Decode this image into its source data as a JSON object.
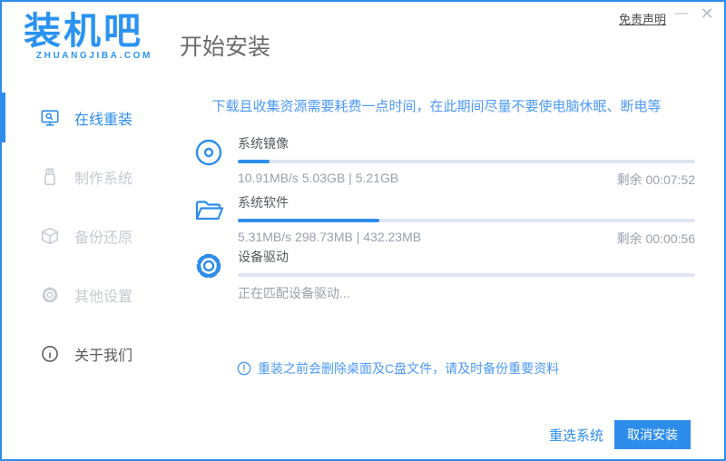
{
  "titlebar": {
    "disclaimer": "免责声明",
    "minimize_glyph": "—",
    "close_glyph": "✕"
  },
  "logo": {
    "brand": "装机吧",
    "domain": "ZHUANGJIBA.COM"
  },
  "header": {
    "title": "开始安装"
  },
  "sidebar": {
    "items": [
      {
        "label": "在线重装",
        "icon": "monitor-reinstall-icon",
        "active": true
      },
      {
        "label": "制作系统",
        "icon": "usb-drive-icon",
        "active": false
      },
      {
        "label": "备份还原",
        "icon": "backup-box-icon",
        "active": false
      },
      {
        "label": "其他设置",
        "icon": "gear-icon",
        "active": false
      },
      {
        "label": "关于我们",
        "icon": "info-icon",
        "active": false
      }
    ]
  },
  "main": {
    "warning": "下载且收集资源需要耗费一点时间，在此期间尽量不要使电脑休眠、断电等",
    "tasks": [
      {
        "name": "系统镜像",
        "icon": "disc-icon",
        "progress_percent": 7,
        "stats": "10.91MB/s 5.03GB | 5.21GB",
        "remaining": "剩余 00:07:52"
      },
      {
        "name": "系统软件",
        "icon": "folder-icon",
        "progress_percent": 31,
        "stats": "5.31MB/s 298.73MB | 432.23MB",
        "remaining": "剩余 00:00:56"
      },
      {
        "name": "设备驱动",
        "icon": "gear-icon",
        "progress_percent": 0,
        "status": "正在匹配设备驱动..."
      }
    ],
    "note": "重装之前会删除桌面及C盘文件，请及时备份重要资料"
  },
  "footer": {
    "reselect_label": "重选系统",
    "cancel_label": "取消安装"
  },
  "colors": {
    "accent_blue": "#2E8DEB",
    "logo_blue": "#2B93F2",
    "info_blue": "#4D9AF5",
    "track_gray": "#DFE5F0",
    "disabled_gray": "#C6CAD2",
    "text_gray": "#99A1AD"
  }
}
